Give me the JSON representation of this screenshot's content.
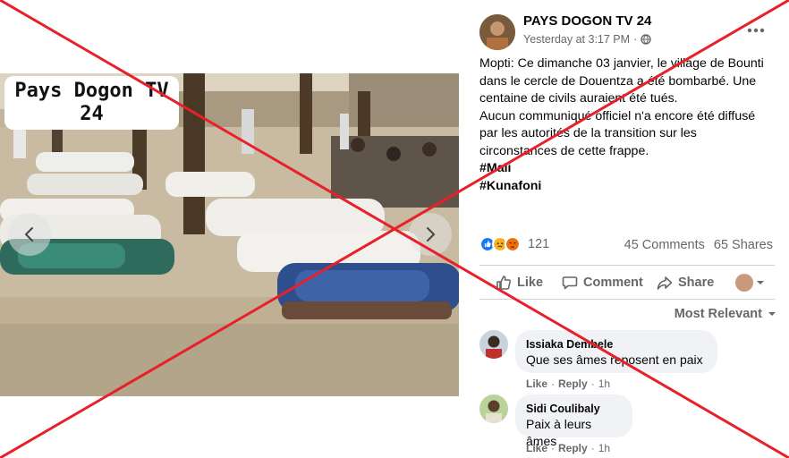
{
  "photo": {
    "watermark_line1": "Pays Dogon TV",
    "watermark_line2": "24",
    "prev_icon": "chevron-left-icon",
    "next_icon": "chevron-right-icon"
  },
  "post": {
    "page_name": "PAYS DOGON TV 24",
    "time": "Yesterday at 3:17 PM",
    "privacy_separator": "·",
    "privacy_icon": "globe-icon",
    "more_icon": "more-horizontal-icon",
    "text_p1": "Mopti: Ce dimanche 03 janvier, le village de Bounti dans le cercle de Douentza a été bombarbé. Une centaine de civils auraient été tués.",
    "text_p2": "Aucun communiqué officiel n'a encore été diffusé par les autorités de la transition sur les circonstances de cette frappe.",
    "hashtags": [
      "#Mali",
      "#Kunafoni"
    ]
  },
  "reactions": {
    "icons": [
      "like-reaction-icon",
      "sad-reaction-icon",
      "angry-reaction-icon"
    ],
    "count": "121",
    "comments": "45 Comments",
    "shares": "65 Shares"
  },
  "actions": {
    "like": "Like",
    "comment": "Comment",
    "share": "Share"
  },
  "comments_sort": "Most Relevant",
  "comments": [
    {
      "author": "Issiaka Dembele",
      "text": "Que ses âmes reposent en paix",
      "like": "Like",
      "reply": "Reply",
      "separator": "·",
      "time": "1h"
    },
    {
      "author": "Sidi Coulibaly",
      "text": "Paix à leurs âmes",
      "like": "Like",
      "reply": "Reply",
      "separator": "·",
      "time": "1h"
    }
  ],
  "colors": {
    "overlay_x": "#e8202a",
    "facebook_blue": "#1877f2",
    "secondary_text": "#65676b",
    "bubble": "#f0f2f5"
  }
}
